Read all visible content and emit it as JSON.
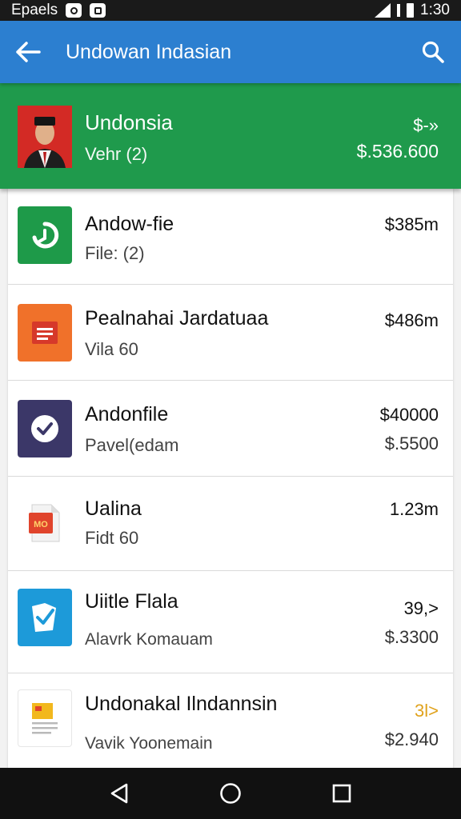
{
  "status_bar": {
    "left_text": "Epaels",
    "time": "1:30"
  },
  "app_bar": {
    "title": "Undowan Indasian",
    "back_icon": "arrow-left-icon",
    "search_icon": "search-icon"
  },
  "header_card": {
    "title": "Undonsia",
    "subtitle": "Vehr (2)",
    "value_top": "$-»",
    "value_bottom": "$.536.600",
    "background": "#1f9a4c"
  },
  "items": [
    {
      "title": "Andow-fie",
      "subtitle": "File: (2)",
      "value_top": "$385m",
      "value_bottom": "",
      "icon": "green-timer-icon",
      "icon_color": "#1e9a49"
    },
    {
      "title": "Pealnahai Jardatuaa",
      "subtitle": "Vila 60",
      "value_top": "$486m",
      "value_bottom": "",
      "icon": "orange-document-icon",
      "icon_color": "#f0712a"
    },
    {
      "title": "Andonfile",
      "subtitle": "Pavel(edam",
      "value_top": "$40000",
      "value_bottom": "$.5500",
      "icon": "checkmark-icon",
      "icon_color": "#3b3768"
    },
    {
      "title": "Ualina",
      "subtitle": "Fidt 60",
      "value_top": "1.23m",
      "value_bottom": "",
      "icon": "pdf-file-icon",
      "icon_color": "#e0442c",
      "icon_text": "MO"
    },
    {
      "title": "Uiitle Flala",
      "subtitle": "Alavrk Komauam",
      "value_top": "39,>",
      "value_bottom": "$.3300",
      "icon": "blue-shield-icon",
      "icon_color": "#1d9ad9"
    },
    {
      "title": "Undonakal Ilndannsin",
      "subtitle": "Vavik Yoonemain",
      "value_top": "3l>",
      "value_bottom": "$2.940",
      "icon": "notes-icon",
      "icon_color": "#f2b81d",
      "value_top_color": "#e0a21c"
    }
  ],
  "nav_bar": {
    "back": "nav-back-icon",
    "home": "nav-home-icon",
    "recents": "nav-recents-icon"
  }
}
